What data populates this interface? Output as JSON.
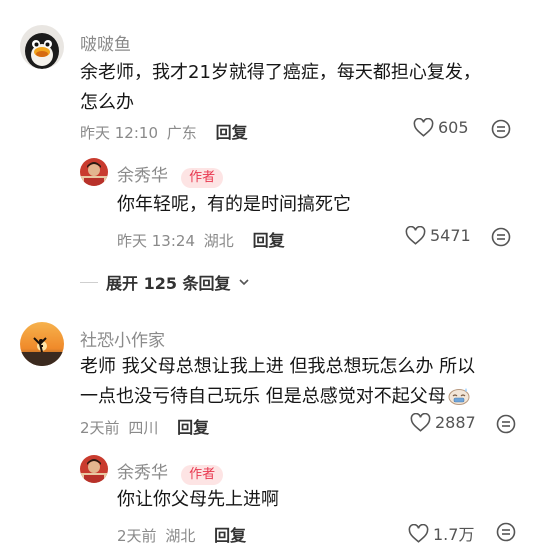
{
  "comments": [
    {
      "username": "啵啵鱼",
      "text_lines": [
        "余老师，我才21岁就得了癌症，每天都担心复发，",
        "怎么办"
      ],
      "time": "昨天 12:10",
      "location": "广东",
      "reply_label": "回复",
      "likes": "605",
      "reply": {
        "username": "余秀华",
        "badge": "作者",
        "text": "你年轻呢，有的是时间搞死它",
        "time": "昨天 13:24",
        "location": "湖北",
        "reply_label": "回复",
        "likes": "5471"
      },
      "expand_label": "展开 125 条回复"
    },
    {
      "username": "社恐小作家",
      "text_lines": [
        "老师 我父母总想让我上进 但我总想玩怎么办 所以",
        "一点也没亏待自己玩乐 但是总感觉对不起父母"
      ],
      "time": "2天前",
      "location": "四川",
      "reply_label": "回复",
      "likes": "2887",
      "reply": {
        "username": "余秀华",
        "badge": "作者",
        "text": "你让你父母先上进啊",
        "time": "2天前",
        "location": "湖北",
        "reply_label": "回复",
        "likes": "1.7万"
      }
    }
  ],
  "icons": {
    "like": "heart-outline-icon",
    "more": "comment-bubble-icon"
  }
}
